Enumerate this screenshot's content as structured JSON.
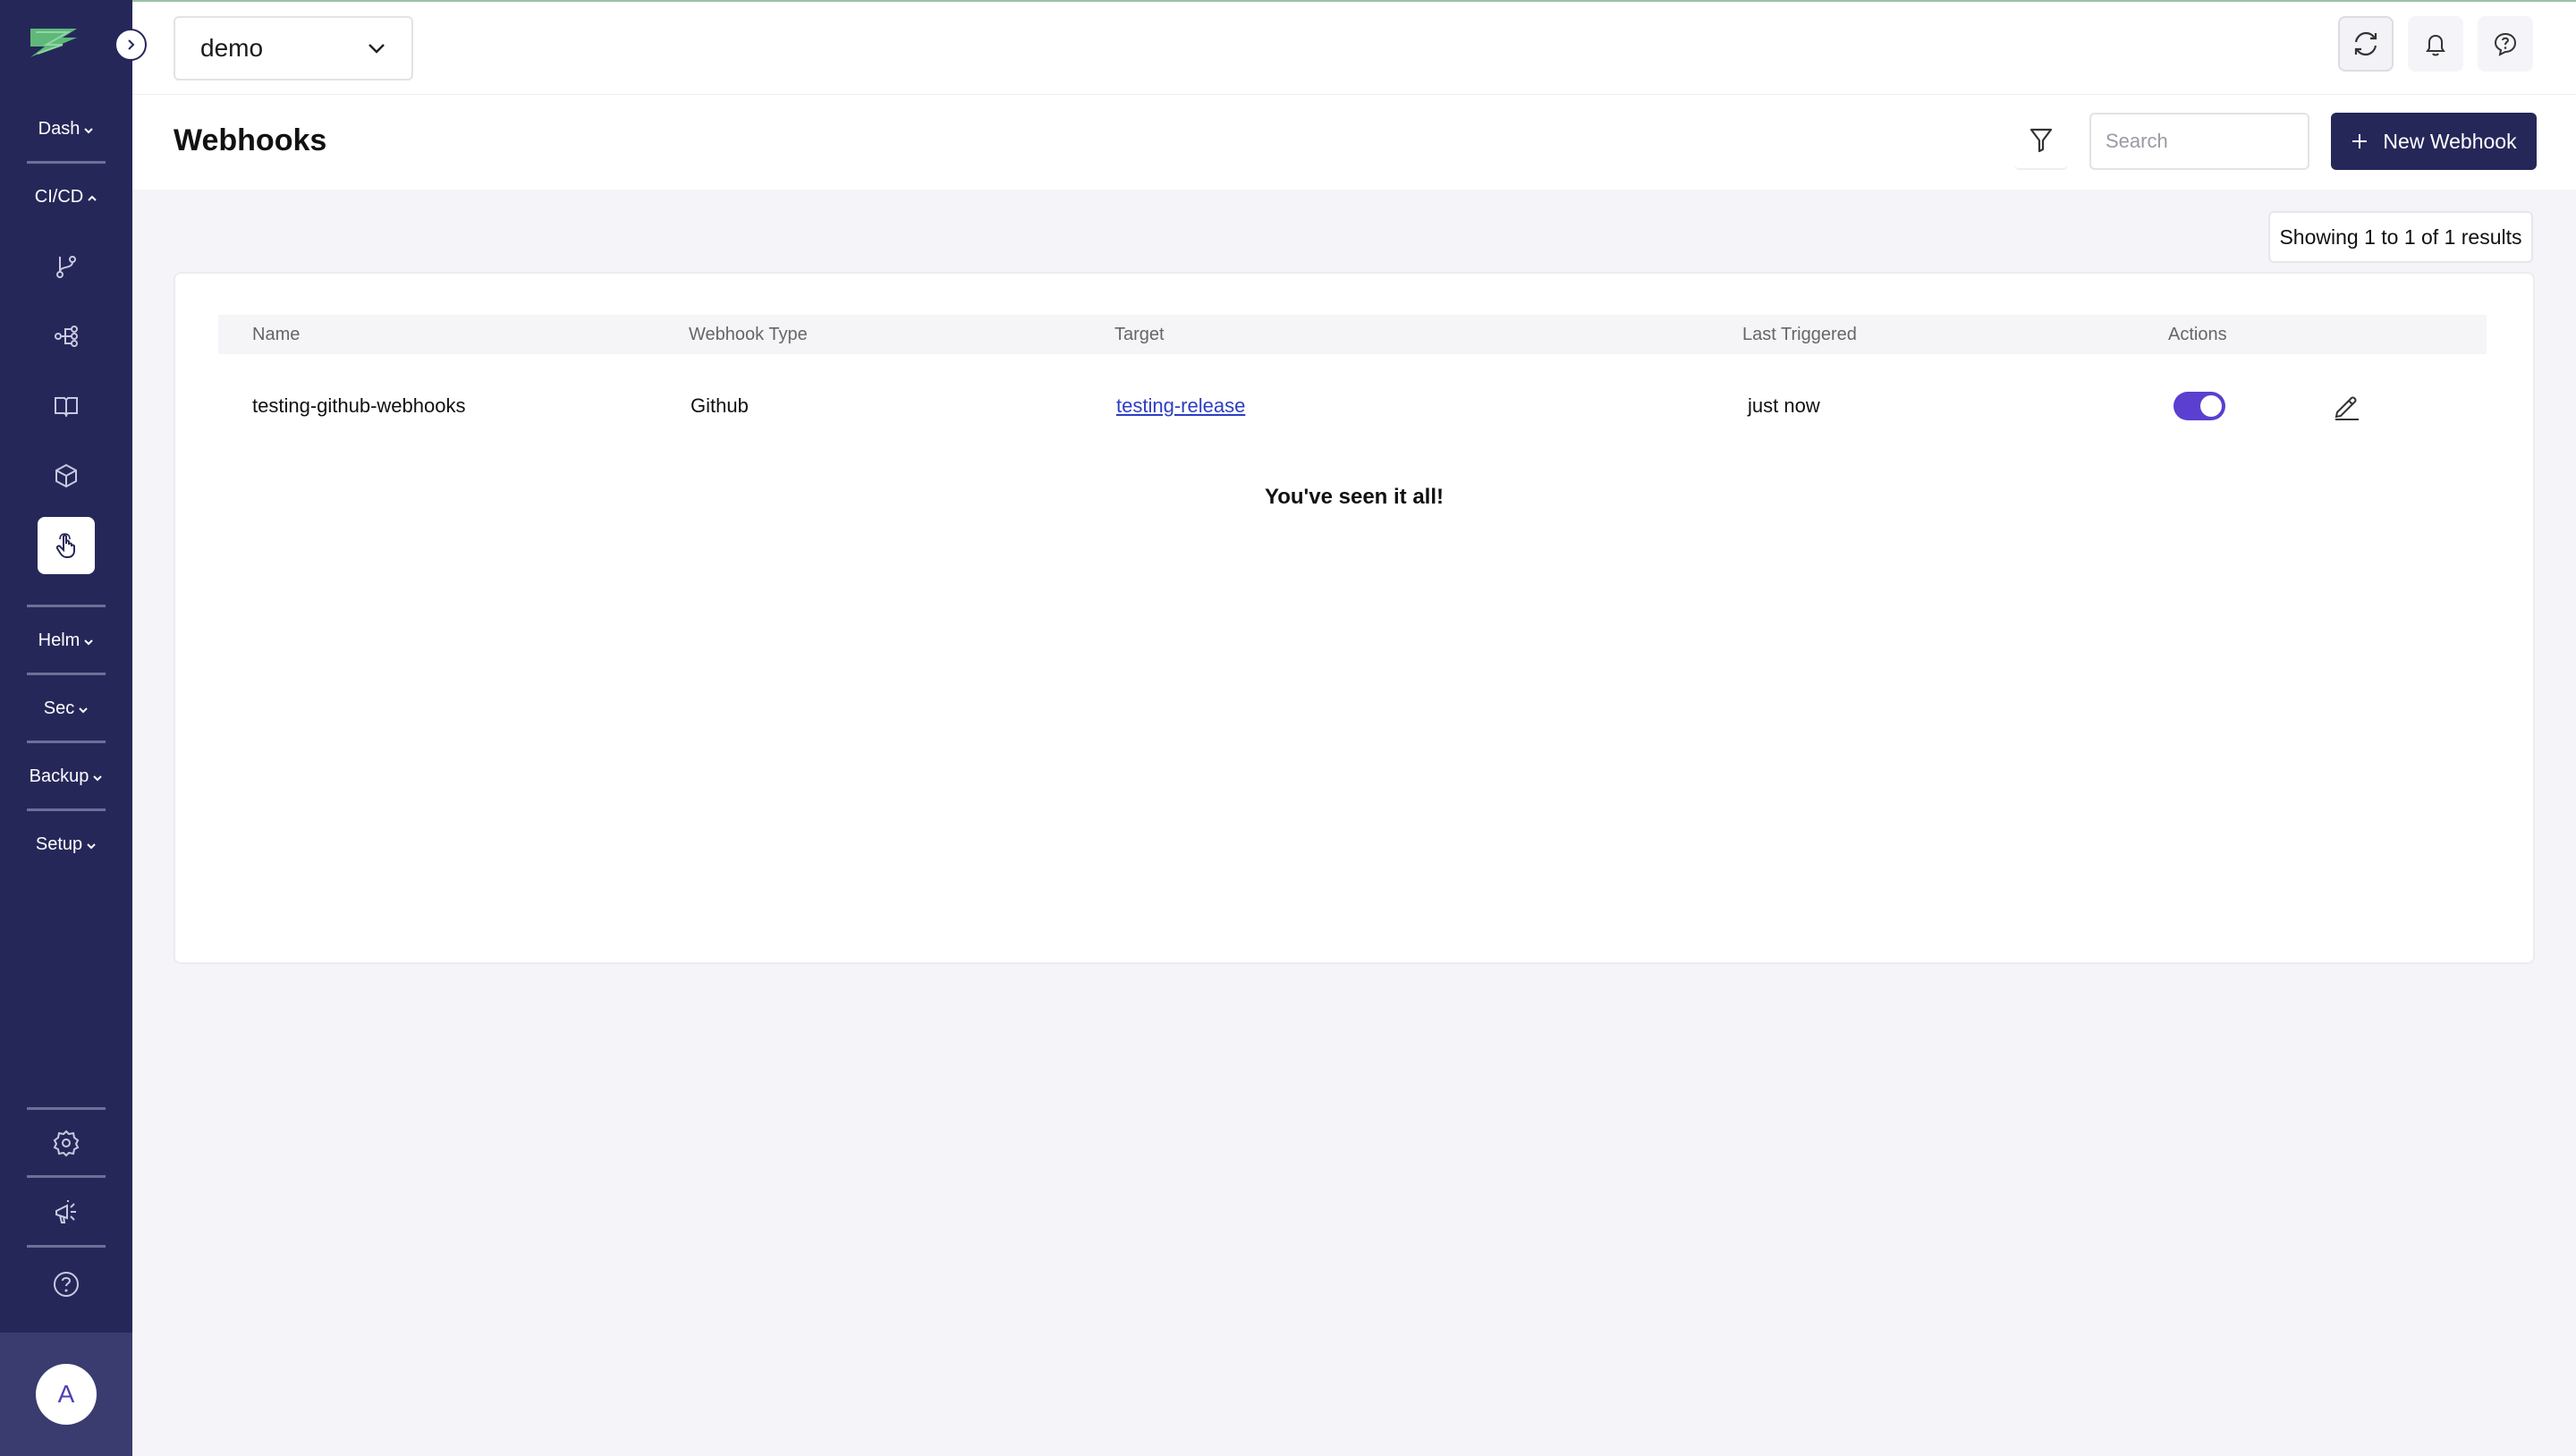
{
  "sidebar": {
    "sections": {
      "dash": "Dash",
      "cicd": "CI/CD",
      "helm": "Helm",
      "sec": "Sec",
      "backup": "Backup",
      "setup": "Setup"
    },
    "cicd_items": [
      "branch-icon",
      "pipeline-icon",
      "book-icon",
      "package-icon",
      "webhook-hand-icon"
    ],
    "active_item": "webhook-hand-icon",
    "avatar_initial": "A"
  },
  "topbar": {
    "workspace": "demo"
  },
  "header": {
    "title": "Webhooks",
    "search_placeholder": "Search",
    "new_button_label": "New Webhook"
  },
  "results_text": "Showing 1 to 1 of 1 results",
  "table": {
    "columns": [
      "Name",
      "Webhook Type",
      "Target",
      "Last Triggered",
      "Actions"
    ],
    "rows": [
      {
        "name": "testing-github-webhooks",
        "type": "Github",
        "target": "testing-release",
        "last_triggered": "just now",
        "enabled": true
      }
    ]
  },
  "end_message": "You've seen it all!",
  "colors": {
    "sidebar": "#262759",
    "accent": "#5a3fd0",
    "link": "#2c3ec4"
  }
}
